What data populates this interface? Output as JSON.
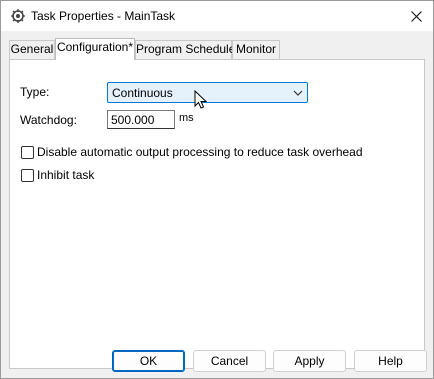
{
  "window": {
    "title": "Task Properties - MainTask"
  },
  "tabs": [
    {
      "label": "General",
      "active": false
    },
    {
      "label": "Configuration*",
      "active": true
    },
    {
      "label": "Program Schedule",
      "active": false
    },
    {
      "label": "Monitor",
      "active": false
    }
  ],
  "config": {
    "type_label": "Type:",
    "type_value": "Continuous",
    "watchdog_label": "Watchdog:",
    "watchdog_value": "500.000",
    "watchdog_unit": "ms",
    "disable_output_label": "Disable automatic output processing to reduce task overhead",
    "disable_output_checked": false,
    "inhibit_label": "Inhibit task",
    "inhibit_checked": false
  },
  "buttons": {
    "ok": "OK",
    "cancel": "Cancel",
    "apply": "Apply",
    "help": "Help"
  },
  "icons": {
    "title": "task-gear-icon",
    "close": "close-icon",
    "dropdown": "chevron-down-icon",
    "cursor": "mouse-pointer-icon"
  },
  "colors": {
    "accent": "#0078d7",
    "combo_highlight": "#e5f1fb",
    "dialog_background": "#f0f0f0"
  }
}
